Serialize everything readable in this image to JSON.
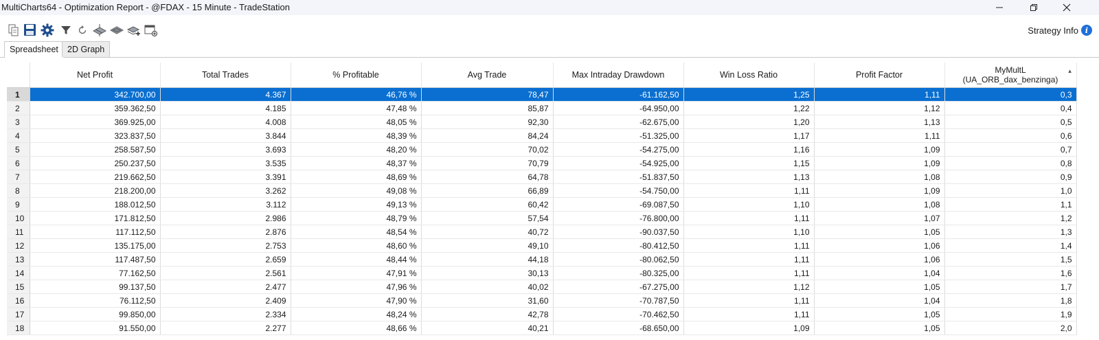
{
  "window": {
    "title": "MultiCharts64 - Optimization Report - @FDAX - 15 Minute - TradeStation"
  },
  "toolbar": {
    "icons": [
      "copy-icon",
      "save-icon",
      "settings-gear-icon",
      "filter-icon",
      "refresh-icon",
      "3d-surface-icon",
      "layers-icon",
      "add-layer-icon",
      "new-window-icon"
    ],
    "strategy_info_label": "Strategy Info",
    "info_icon": "i"
  },
  "tabs": [
    {
      "label": "Spreadsheet",
      "active": true
    },
    {
      "label": "2D Graph",
      "active": false
    }
  ],
  "table": {
    "columns": [
      {
        "label": "Net Profit"
      },
      {
        "label": "Total Trades"
      },
      {
        "label": "% Profitable"
      },
      {
        "label": "Avg Trade"
      },
      {
        "label": "Max Intraday Drawdown"
      },
      {
        "label": "Win Loss Ratio"
      },
      {
        "label": "Profit Factor"
      },
      {
        "label": "MyMultL",
        "sub": "(UA_ORB_dax_benzinga)"
      }
    ],
    "selected_row": 0,
    "rows": [
      [
        "1",
        "342.700,00",
        "4.367",
        "46,76 %",
        "78,47",
        "-61.162,50",
        "1,25",
        "1,11",
        "0,3"
      ],
      [
        "2",
        "359.362,50",
        "4.185",
        "47,48 %",
        "85,87",
        "-64.950,00",
        "1,22",
        "1,12",
        "0,4"
      ],
      [
        "3",
        "369.925,00",
        "4.008",
        "48,05 %",
        "92,30",
        "-62.675,00",
        "1,20",
        "1,13",
        "0,5"
      ],
      [
        "4",
        "323.837,50",
        "3.844",
        "48,39 %",
        "84,24",
        "-51.325,00",
        "1,17",
        "1,11",
        "0,6"
      ],
      [
        "5",
        "258.587,50",
        "3.693",
        "48,20 %",
        "70,02",
        "-54.275,00",
        "1,16",
        "1,09",
        "0,7"
      ],
      [
        "6",
        "250.237,50",
        "3.535",
        "48,37 %",
        "70,79",
        "-54.925,00",
        "1,15",
        "1,09",
        "0,8"
      ],
      [
        "7",
        "219.662,50",
        "3.391",
        "48,69 %",
        "64,78",
        "-51.837,50",
        "1,13",
        "1,08",
        "0,9"
      ],
      [
        "8",
        "218.200,00",
        "3.262",
        "49,08 %",
        "66,89",
        "-54.750,00",
        "1,11",
        "1,09",
        "1,0"
      ],
      [
        "9",
        "188.012,50",
        "3.112",
        "49,13 %",
        "60,42",
        "-69.087,50",
        "1,10",
        "1,08",
        "1,1"
      ],
      [
        "10",
        "171.812,50",
        "2.986",
        "48,79 %",
        "57,54",
        "-76.800,00",
        "1,11",
        "1,07",
        "1,2"
      ],
      [
        "11",
        "117.112,50",
        "2.876",
        "48,54 %",
        "40,72",
        "-90.037,50",
        "1,10",
        "1,05",
        "1,3"
      ],
      [
        "12",
        "135.175,00",
        "2.753",
        "48,60 %",
        "49,10",
        "-80.412,50",
        "1,11",
        "1,06",
        "1,4"
      ],
      [
        "13",
        "117.487,50",
        "2.659",
        "48,44 %",
        "44,18",
        "-80.062,50",
        "1,11",
        "1,06",
        "1,5"
      ],
      [
        "14",
        "77.162,50",
        "2.561",
        "47,91 %",
        "30,13",
        "-80.325,00",
        "1,11",
        "1,04",
        "1,6"
      ],
      [
        "15",
        "99.137,50",
        "2.477",
        "47,96 %",
        "40,02",
        "-67.275,00",
        "1,12",
        "1,05",
        "1,7"
      ],
      [
        "16",
        "76.112,50",
        "2.409",
        "47,90 %",
        "31,60",
        "-70.787,50",
        "1,11",
        "1,04",
        "1,8"
      ],
      [
        "17",
        "99.850,00",
        "2.334",
        "48,24 %",
        "42,78",
        "-70.462,50",
        "1,11",
        "1,05",
        "1,9"
      ],
      [
        "18",
        "91.550,00",
        "2.277",
        "48,66 %",
        "40,21",
        "-68.650,00",
        "1,09",
        "1,05",
        "2,0"
      ]
    ]
  },
  "colors": {
    "selection": "#0a6fd1",
    "accent_info": "#1e6fd9"
  }
}
